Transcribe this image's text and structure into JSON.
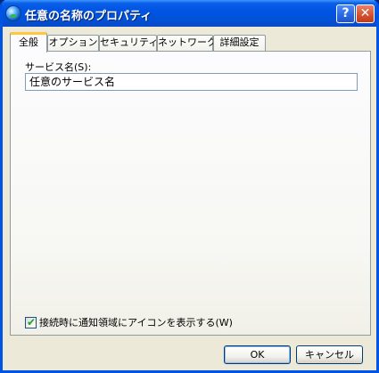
{
  "window": {
    "title": "任意の名称のプロパティ"
  },
  "titlebar": {
    "help_glyph": "?",
    "close_glyph": "✕"
  },
  "tabs": [
    {
      "label": "全般",
      "active": true
    },
    {
      "label": "オプション",
      "active": false
    },
    {
      "label": "セキュリティ",
      "active": false
    },
    {
      "label": "ネットワーク",
      "active": false
    },
    {
      "label": "詳細設定",
      "active": false
    }
  ],
  "general": {
    "service_name_label": "サービス名(S):",
    "service_name_value": "任意のサービス名",
    "show_icon_checkbox": {
      "label": "接続時に通知領域にアイコンを表示する(W)",
      "checked": true
    }
  },
  "buttons": {
    "ok": "OK",
    "cancel": "キャンセル"
  },
  "colors": {
    "titlebar": "#0054e3",
    "dialog_bg": "#ece9d8",
    "active_tab_accent": "#ffc83c",
    "checkmark": "#21a121"
  }
}
